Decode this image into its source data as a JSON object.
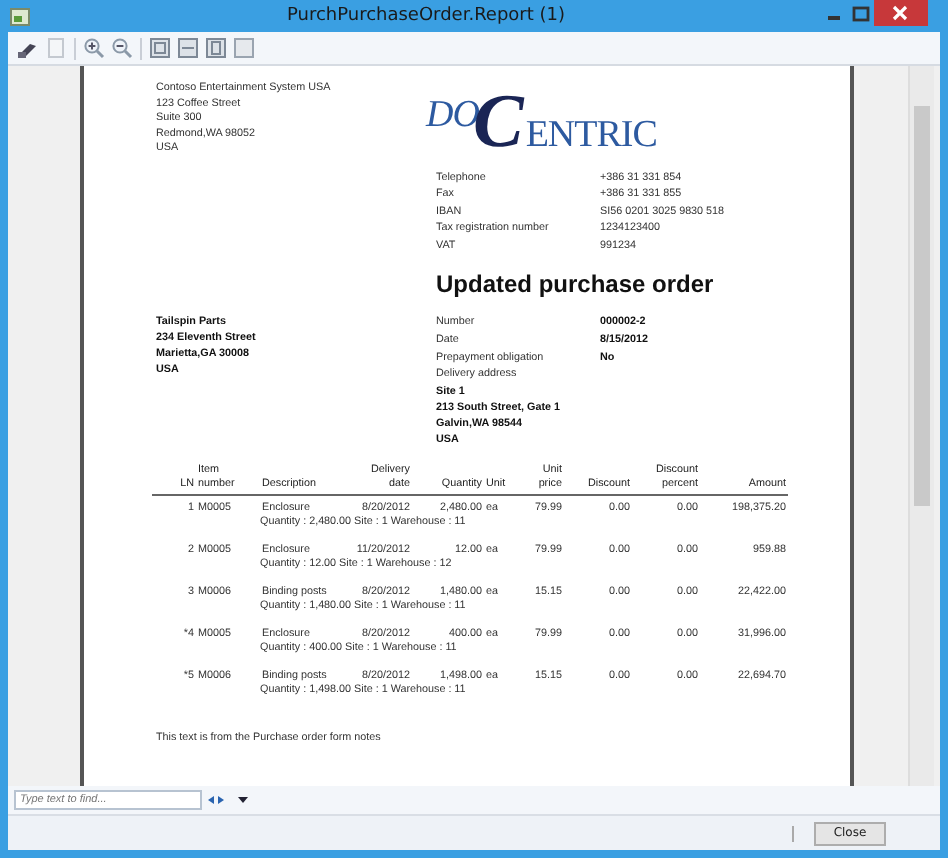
{
  "window": {
    "title": "PurchPurchaseOrder.Report (1)"
  },
  "sender": [
    "Contoso Entertainment System USA",
    "123 Coffee Street",
    "Suite 300",
    "Redmond,WA 98052",
    "USA"
  ],
  "logo": {
    "before": "DO",
    "big": "C",
    "after": "ENTRIC"
  },
  "company_info": [
    {
      "label": "Telephone",
      "value": "+386 31 331 854"
    },
    {
      "label": "Fax",
      "value": "+386 31 331 855"
    },
    {
      "label": "IBAN",
      "value": "SI56 0201 3025 9830 518"
    },
    {
      "label": "Tax registration number",
      "value": "1234123400"
    },
    {
      "label": "VAT",
      "value": "991234"
    }
  ],
  "document_title": "Updated purchase order",
  "vendor": [
    "Tailspin Parts",
    "234 Eleventh Street",
    "Marietta,GA 30008",
    "USA"
  ],
  "order_info": [
    {
      "label": "Number",
      "value": "000002-2"
    },
    {
      "label": "Date",
      "value": "8/15/2012"
    },
    {
      "label": "Prepayment obligation",
      "value": "No"
    },
    {
      "label": "Delivery address"
    }
  ],
  "delivery_address": [
    "Site 1",
    "213 South Street, Gate 1",
    "Galvin,WA 98544",
    "USA"
  ],
  "table": {
    "columns": [
      "LN",
      "Item number",
      "Description",
      "Delivery date",
      "Quantity",
      "Unit",
      "Unit price",
      "Discount",
      "Discount percent",
      "Amount"
    ],
    "rows": [
      {
        "cells": [
          "1",
          "M0005",
          "Enclosure",
          "8/20/2012",
          "2,480.00",
          "ea",
          "79.99",
          "0.00",
          "0.00",
          "198,375.20"
        ],
        "detail": "Quantity : 2,480.00  Site : 1   Warehouse : 11"
      },
      {
        "cells": [
          "2",
          "M0005",
          "Enclosure",
          "11/20/2012",
          "12.00",
          "ea",
          "79.99",
          "0.00",
          "0.00",
          "959.88"
        ],
        "detail": "Quantity : 12.00  Site : 1   Warehouse : 12"
      },
      {
        "cells": [
          "3",
          "M0006",
          "Binding posts",
          "8/20/2012",
          "1,480.00",
          "ea",
          "15.15",
          "0.00",
          "0.00",
          "22,422.00"
        ],
        "detail": "Quantity : 1,480.00  Site : 1   Warehouse : 11"
      },
      {
        "cells": [
          "*4",
          "M0005",
          "Enclosure",
          "8/20/2012",
          "400.00",
          "ea",
          "79.99",
          "0.00",
          "0.00",
          "31,996.00"
        ],
        "detail": "Quantity : 400.00  Site : 1   Warehouse : 11"
      },
      {
        "cells": [
          "*5",
          "M0006",
          "Binding posts",
          "8/20/2012",
          "1,498.00",
          "ea",
          "15.15",
          "0.00",
          "0.00",
          "22,694.70"
        ],
        "detail": "Quantity : 1,498.00  Site : 1   Warehouse : 11"
      }
    ]
  },
  "notes": "This text is from the Purchase order form notes",
  "find": {
    "placeholder": "Type text to find..."
  },
  "buttons": [
    "Close"
  ]
}
